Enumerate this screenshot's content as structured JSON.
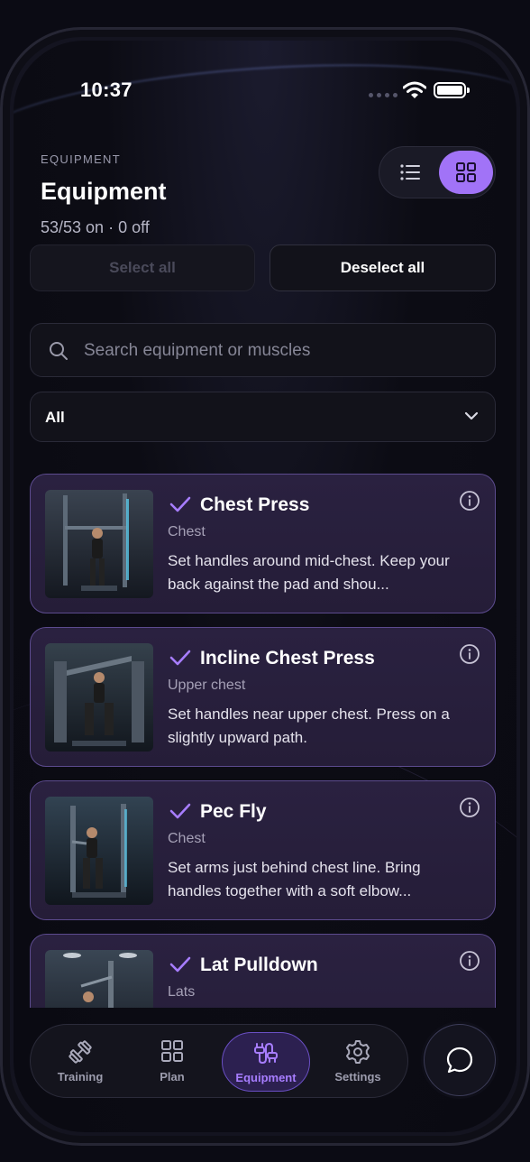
{
  "status": {
    "time": "10:37"
  },
  "header": {
    "eyebrow": "EQUIPMENT",
    "title": "Equipment",
    "subtitle": "53/53 on · 0 off",
    "view_toggle": {
      "options": [
        "list-icon",
        "grid-icon"
      ],
      "selected": "grid"
    }
  },
  "actions": {
    "select_all": "Select all",
    "deselect_all": "Deselect all"
  },
  "search": {
    "placeholder": "Search equipment or muscles"
  },
  "filter": {
    "value": "All"
  },
  "equipment": [
    {
      "name": "Chest Press",
      "muscle": "Chest",
      "description": "Set handles around mid-chest. Keep your back against the pad and shou...",
      "selected": true
    },
    {
      "name": "Incline Chest Press",
      "muscle": "Upper chest",
      "description": "Set handles near upper chest. Press on a slightly upward path.",
      "selected": true
    },
    {
      "name": "Pec Fly",
      "muscle": "Chest",
      "description": "Set arms just behind chest line. Bring handles together with a soft elbow...",
      "selected": true
    },
    {
      "name": "Lat Pulldown",
      "muscle": "Lats",
      "description": "",
      "selected": true
    }
  ],
  "tabbar": {
    "tabs": [
      {
        "label": "Training",
        "icon": "dumbbell-icon"
      },
      {
        "label": "Plan",
        "icon": "grid-icon"
      },
      {
        "label": "Equipment",
        "icon": "cable-icon"
      },
      {
        "label": "Settings",
        "icon": "gear-icon"
      }
    ],
    "active": "Equipment"
  },
  "chat": {
    "icon": "chat-bubble-icon"
  },
  "colors": {
    "accent": "#a173f7",
    "card_border": "#5c4b8e",
    "card_bg": "#2a2140",
    "active_tab_bg": "#2c2050"
  }
}
